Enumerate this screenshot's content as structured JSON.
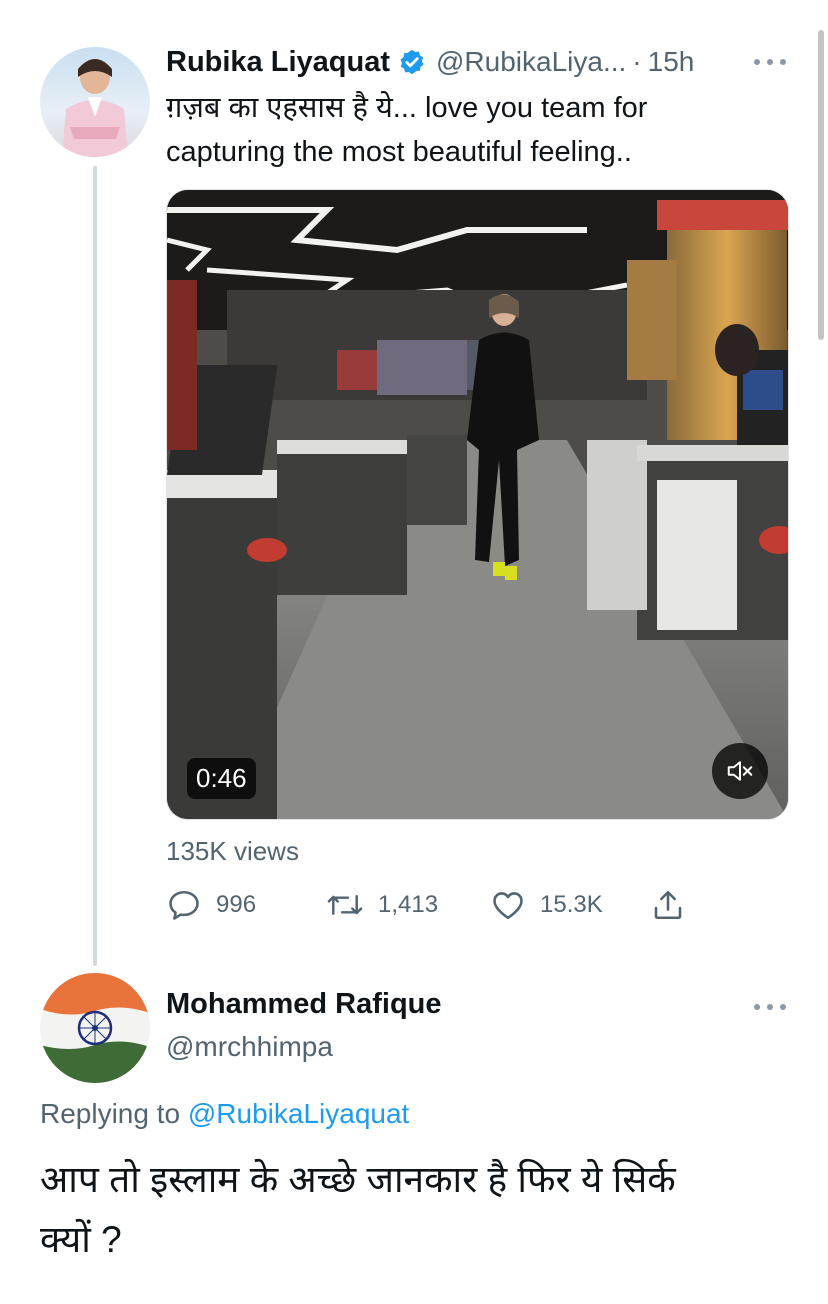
{
  "tweet": {
    "author_name": "Rubika Liyaquat",
    "handle": "@RubikaLiya...",
    "separator": "·",
    "time": "15h",
    "text_line1": "ग़ज़ब का एहसास है ये... love you team for",
    "text_line2": "capturing the most beautiful feeling..",
    "video": {
      "duration": "0:46"
    },
    "views": "135K views",
    "actions": {
      "replies": "996",
      "retweets": "1,413",
      "likes": "15.3K"
    }
  },
  "reply": {
    "author_name": "Mohammed Rafique",
    "handle": "@mrchhimpa",
    "replying_prefix": "Replying to",
    "replying_to": "@RubikaLiyaquat",
    "text_line1": "आप तो इस्लाम के अच्छे जानकार है फिर ये सिर्क",
    "text_line2": "क्यों ?"
  },
  "icons": {
    "verified": "verified-badge-icon",
    "more": "more-options-icon",
    "reply": "reply-icon",
    "retweet": "retweet-icon",
    "like": "heart-icon",
    "share": "share-icon",
    "mute": "speaker-muted-icon"
  },
  "colors": {
    "link": "#1d9bf0",
    "secondary_text": "#536471",
    "primary_text": "#0f1419",
    "thread_line": "#cfd9de"
  }
}
